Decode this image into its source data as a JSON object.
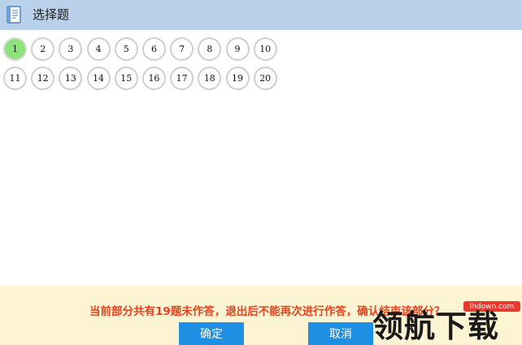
{
  "header": {
    "title": "选择题",
    "icon": "document-icon"
  },
  "questions": {
    "current": "1",
    "rows": [
      [
        "1",
        "2",
        "3",
        "4",
        "5",
        "6",
        "7",
        "8",
        "9",
        "10"
      ],
      [
        "11",
        "12",
        "13",
        "14",
        "15",
        "16",
        "17",
        "18",
        "19",
        "20"
      ]
    ]
  },
  "footer": {
    "warning": "当前部分共有19题未作答，退出后不能再次进行作答，确认结束该部分？",
    "ok_label": "确定",
    "cancel_label": "取消"
  },
  "watermark": {
    "tag": "lhdown.com",
    "text": "领航下载"
  },
  "colors": {
    "header_bg": "#b9d1ea",
    "current_question": "#8fe37b",
    "footer_bg": "#fdf4d3",
    "warning_text": "#e8411c",
    "button_bg": "#1e8fe3"
  }
}
